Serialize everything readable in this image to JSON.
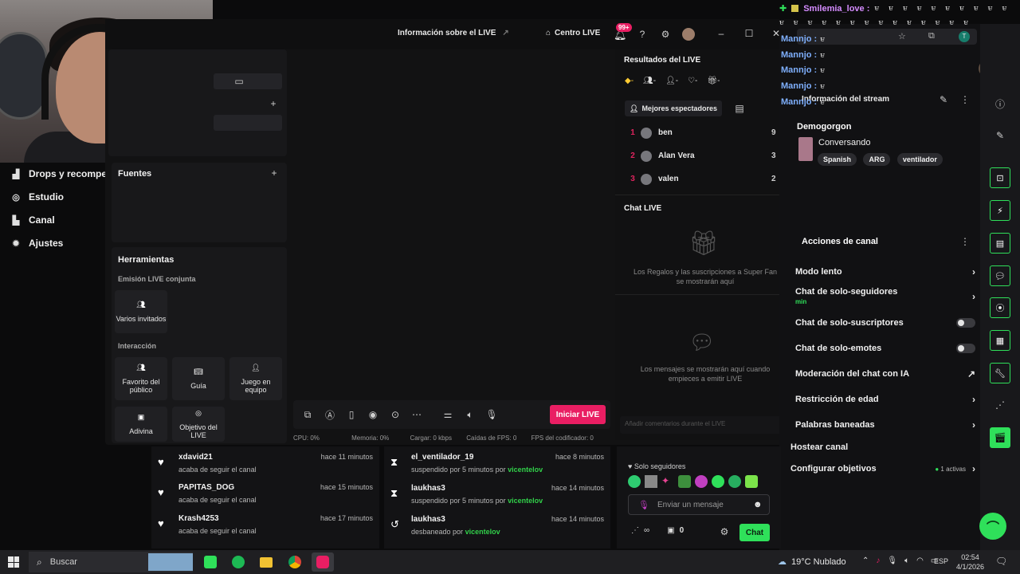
{
  "webcam": {
    "label": ""
  },
  "left_nav": {
    "items": [
      {
        "label": "Drops y recompe",
        "icon": "gift-icon"
      },
      {
        "label": "Estudio",
        "icon": "studio-icon"
      },
      {
        "label": "Canal",
        "icon": "channel-icon"
      },
      {
        "label": "Ajustes",
        "icon": "gear-icon"
      }
    ]
  },
  "studio": {
    "header": {
      "live_info": "Información sobre el LIVE",
      "live_center": "Centro LIVE",
      "notif_badge": "99+"
    },
    "sources": {
      "title": "Fuentes"
    },
    "tools": {
      "title": "Herramientas",
      "section_joint": "Emisión LIVE conjunta",
      "multi_guests": "Varios invitados",
      "section_interaction": "Interacción",
      "favorite": "Favorito del público",
      "guide": "Guía",
      "team_game": "Juego en equipo",
      "guess": "Adivina",
      "goal": "Objetivo del LIVE"
    },
    "start_live": "Iniciar LIVE",
    "stats": {
      "cpu": "CPU: 0%",
      "memory": "Memoria: 0%",
      "upload": "Cargar: 0 kbps",
      "fps_drops": "Caídas de FPS: 0",
      "fps_encoder": "FPS del codificador: 0"
    },
    "results": {
      "title": "Resultados del LIVE",
      "top_viewers": "Mejores espectadores",
      "rankings": [
        {
          "rank": "1",
          "name": "ben",
          "score": "9"
        },
        {
          "rank": "2",
          "name": "Alan Vera",
          "score": "3"
        },
        {
          "rank": "3",
          "name": "valen",
          "score": "2"
        }
      ],
      "chat_title": "Chat LIVE",
      "gifts_msg": "Los Regalos y las suscripciones a Super Fan se mostrarán aquí",
      "messages_msg": "Los mensajes se mostrarán aquí cuando empieces a emitir LIVE",
      "comment_placeholder": "Añadir comentarios durante el LIVE"
    }
  },
  "chat_overlay": {
    "top_user": "Smilemia_love :",
    "lines": [
      {
        "name": "Mannjo :"
      },
      {
        "name": "Mannjo :"
      },
      {
        "name": "Mannjo :"
      },
      {
        "name": "Mannjo :"
      },
      {
        "name": "Mannjo :"
      }
    ]
  },
  "dashboard": {
    "stream_info_title": "Información del stream",
    "streamer": "Demogorgon",
    "category": "Conversando",
    "tags": [
      "Spanish",
      "ARG",
      "ventilador"
    ],
    "actions_title": "Acciones de canal",
    "settings": [
      {
        "label": "Modo lento",
        "control": "chevron"
      },
      {
        "label": "Chat de solo-seguidores",
        "control": "chevron",
        "sub": "min"
      },
      {
        "label": "Chat de solo-suscriptores",
        "control": "toggle"
      },
      {
        "label": "Chat de solo-emotes",
        "control": "toggle"
      },
      {
        "label": "Moderación del chat con IA",
        "control": "external"
      },
      {
        "label": "Restricción de edad",
        "control": "chevron"
      },
      {
        "label": "Palabras baneadas",
        "control": "chevron"
      },
      {
        "label": "Hostear canal",
        "control": "none"
      },
      {
        "label": "Configurar objetivos",
        "control": "chevron",
        "badge": "1 activas"
      }
    ],
    "chat_input": {
      "mode": "Solo seguidores",
      "placeholder": "Enviar un mensaje",
      "send_label": "Chat",
      "points": "0"
    }
  },
  "activity": {
    "follows": [
      {
        "name": "xdavid21",
        "desc": "acaba de seguir el canal",
        "time": "hace 11 minutos"
      },
      {
        "name": "PAPITAS_DOG",
        "desc": "acaba de seguir el canal",
        "time": "hace 15 minutos"
      },
      {
        "name": "Krash4253",
        "desc": "acaba de seguir el canal",
        "time": "hace 17 minutos"
      }
    ],
    "mod": [
      {
        "name": "el_ventilador_19",
        "desc": "suspendido por 5 minutos por",
        "by": "vicentelov",
        "time": "hace 8 minutos",
        "icon": "hourglass-icon"
      },
      {
        "name": "laukhas3",
        "desc": "suspendido por 5 minutos por",
        "by": "vicentelov",
        "time": "hace 14 minutos",
        "icon": "hourglass-icon"
      },
      {
        "name": "laukhas3",
        "desc": "desbaneado por",
        "by": "vicentelov",
        "time": "hace 14 minutos",
        "icon": "undo-icon"
      }
    ]
  },
  "taskbar": {
    "search": "Buscar",
    "weather": "19°C  Nublado",
    "lang": "ESP",
    "time": "02:54",
    "date": "4/1/2026"
  },
  "colors": {
    "accent": "#e91e63",
    "green": "#2fe05a",
    "link": "#7fb0ff"
  }
}
